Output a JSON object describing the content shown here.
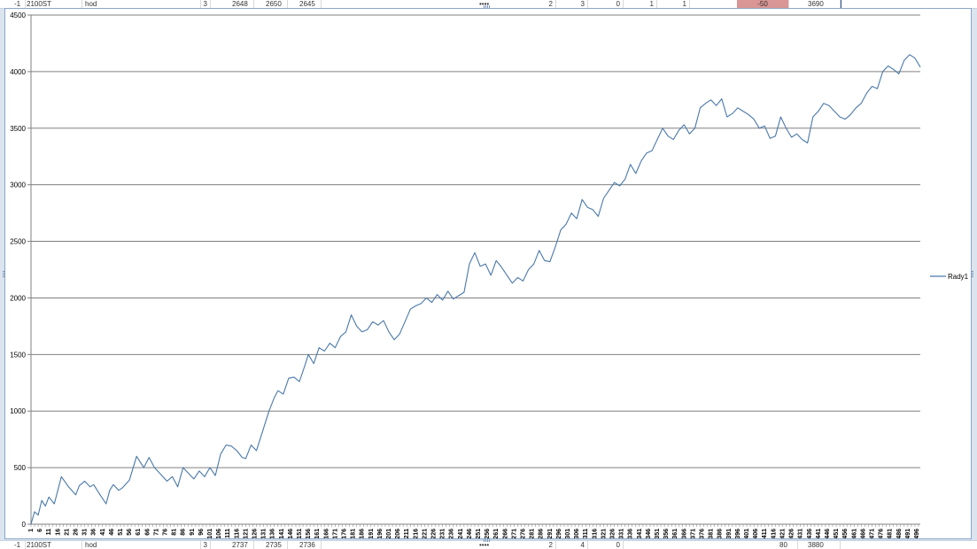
{
  "sheet": {
    "top_row": [
      "-1",
      "2100ST",
      "hod",
      "3",
      "2648",
      "2650",
      "2645",
      "••••",
      "2",
      "3",
      "0",
      "1",
      "1",
      "-50",
      "3690"
    ],
    "bottom_row": [
      "-1",
      "2100ST",
      "hod",
      "3",
      "2737",
      "2735",
      "2736",
      "••••",
      "2",
      "4",
      "0",
      "80",
      "3880"
    ]
  },
  "colors": {
    "line": "#4a78a9",
    "grid": "#808080",
    "border": "#8aa7c9",
    "highlight": "#d99694"
  },
  "chart_data": {
    "type": "line",
    "ylim": [
      0,
      4500
    ],
    "yticks": [
      0,
      500,
      1000,
      1500,
      2000,
      2500,
      3000,
      3500,
      4000,
      4500
    ],
    "grid": "horizontal",
    "legend_position": "right",
    "x_first": 1,
    "x_last": 498,
    "x_tick_step": 5,
    "series": [
      {
        "name": "Rady1",
        "anchors": [
          [
            1,
            0
          ],
          [
            3,
            110
          ],
          [
            5,
            80
          ],
          [
            7,
            210
          ],
          [
            9,
            160
          ],
          [
            11,
            240
          ],
          [
            14,
            180
          ],
          [
            18,
            420
          ],
          [
            22,
            330
          ],
          [
            26,
            260
          ],
          [
            28,
            340
          ],
          [
            31,
            380
          ],
          [
            34,
            330
          ],
          [
            36,
            350
          ],
          [
            40,
            250
          ],
          [
            43,
            180
          ],
          [
            45,
            300
          ],
          [
            47,
            350
          ],
          [
            50,
            300
          ],
          [
            52,
            320
          ],
          [
            56,
            390
          ],
          [
            60,
            600
          ],
          [
            64,
            500
          ],
          [
            67,
            590
          ],
          [
            70,
            500
          ],
          [
            73,
            450
          ],
          [
            77,
            380
          ],
          [
            80,
            420
          ],
          [
            83,
            330
          ],
          [
            86,
            500
          ],
          [
            89,
            450
          ],
          [
            92,
            400
          ],
          [
            95,
            470
          ],
          [
            98,
            420
          ],
          [
            101,
            500
          ],
          [
            104,
            430
          ],
          [
            107,
            620
          ],
          [
            110,
            700
          ],
          [
            113,
            690
          ],
          [
            116,
            650
          ],
          [
            119,
            590
          ],
          [
            121,
            580
          ],
          [
            124,
            700
          ],
          [
            127,
            650
          ],
          [
            130,
            800
          ],
          [
            134,
            1000
          ],
          [
            137,
            1120
          ],
          [
            139,
            1180
          ],
          [
            142,
            1150
          ],
          [
            145,
            1290
          ],
          [
            148,
            1300
          ],
          [
            151,
            1260
          ],
          [
            154,
            1400
          ],
          [
            156,
            1500
          ],
          [
            159,
            1420
          ],
          [
            162,
            1560
          ],
          [
            165,
            1530
          ],
          [
            168,
            1600
          ],
          [
            171,
            1560
          ],
          [
            174,
            1660
          ],
          [
            177,
            1700
          ],
          [
            180,
            1850
          ],
          [
            183,
            1750
          ],
          [
            186,
            1700
          ],
          [
            189,
            1720
          ],
          [
            192,
            1790
          ],
          [
            195,
            1760
          ],
          [
            198,
            1800
          ],
          [
            201,
            1700
          ],
          [
            204,
            1630
          ],
          [
            207,
            1680
          ],
          [
            210,
            1790
          ],
          [
            213,
            1900
          ],
          [
            216,
            1930
          ],
          [
            219,
            1950
          ],
          [
            222,
            2000
          ],
          [
            225,
            1960
          ],
          [
            228,
            2030
          ],
          [
            231,
            1980
          ],
          [
            234,
            2060
          ],
          [
            237,
            1990
          ],
          [
            240,
            2020
          ],
          [
            243,
            2050
          ],
          [
            246,
            2300
          ],
          [
            249,
            2400
          ],
          [
            252,
            2280
          ],
          [
            255,
            2300
          ],
          [
            258,
            2200
          ],
          [
            261,
            2330
          ],
          [
            264,
            2270
          ],
          [
            267,
            2200
          ],
          [
            270,
            2130
          ],
          [
            273,
            2180
          ],
          [
            276,
            2150
          ],
          [
            279,
            2250
          ],
          [
            282,
            2300
          ],
          [
            285,
            2420
          ],
          [
            288,
            2330
          ],
          [
            291,
            2320
          ],
          [
            294,
            2450
          ],
          [
            297,
            2600
          ],
          [
            300,
            2650
          ],
          [
            303,
            2750
          ],
          [
            306,
            2700
          ],
          [
            309,
            2870
          ],
          [
            312,
            2800
          ],
          [
            315,
            2780
          ],
          [
            318,
            2720
          ],
          [
            321,
            2880
          ],
          [
            324,
            2950
          ],
          [
            327,
            3020
          ],
          [
            330,
            2990
          ],
          [
            333,
            3050
          ],
          [
            336,
            3180
          ],
          [
            339,
            3100
          ],
          [
            342,
            3210
          ],
          [
            345,
            3280
          ],
          [
            348,
            3300
          ],
          [
            351,
            3400
          ],
          [
            354,
            3500
          ],
          [
            357,
            3430
          ],
          [
            360,
            3400
          ],
          [
            363,
            3480
          ],
          [
            366,
            3530
          ],
          [
            369,
            3450
          ],
          [
            372,
            3500
          ],
          [
            375,
            3680
          ],
          [
            378,
            3720
          ],
          [
            381,
            3750
          ],
          [
            384,
            3700
          ],
          [
            387,
            3760
          ],
          [
            390,
            3600
          ],
          [
            393,
            3630
          ],
          [
            396,
            3680
          ],
          [
            399,
            3650
          ],
          [
            402,
            3620
          ],
          [
            405,
            3580
          ],
          [
            408,
            3500
          ],
          [
            411,
            3520
          ],
          [
            414,
            3410
          ],
          [
            417,
            3430
          ],
          [
            420,
            3600
          ],
          [
            423,
            3500
          ],
          [
            426,
            3420
          ],
          [
            429,
            3450
          ],
          [
            432,
            3400
          ],
          [
            435,
            3370
          ],
          [
            438,
            3600
          ],
          [
            441,
            3650
          ],
          [
            444,
            3720
          ],
          [
            447,
            3700
          ],
          [
            450,
            3650
          ],
          [
            453,
            3600
          ],
          [
            456,
            3580
          ],
          [
            459,
            3620
          ],
          [
            462,
            3680
          ],
          [
            465,
            3720
          ],
          [
            468,
            3810
          ],
          [
            471,
            3870
          ],
          [
            474,
            3850
          ],
          [
            477,
            4000
          ],
          [
            480,
            4050
          ],
          [
            483,
            4020
          ],
          [
            486,
            3980
          ],
          [
            489,
            4100
          ],
          [
            492,
            4150
          ],
          [
            495,
            4120
          ],
          [
            498,
            4040
          ]
        ]
      }
    ]
  }
}
